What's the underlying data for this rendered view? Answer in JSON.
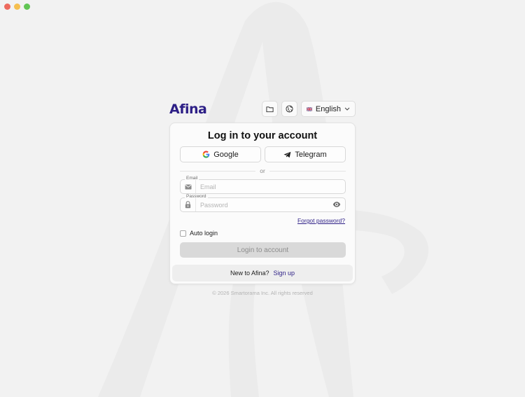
{
  "app": {
    "logo_text": "Afina"
  },
  "topbar": {
    "folder_icon": "folder-icon",
    "globe_icon": "globe-icon",
    "language": {
      "flag_icon": "uk-flag-icon",
      "selected": "English"
    }
  },
  "card": {
    "title": "Log in to your account",
    "social": {
      "google_label": "Google",
      "telegram_label": "Telegram"
    },
    "divider_text": "or",
    "email": {
      "label": "Email",
      "placeholder": "Email",
      "value": ""
    },
    "password": {
      "label": "Password",
      "placeholder": "Password",
      "value": ""
    },
    "forgot_label": "Forgot password?",
    "auto_login_label": "Auto login",
    "auto_login_checked": false,
    "login_label": "Login to account",
    "signup_prompt": "New to Afina?",
    "signup_label": "Sign up"
  },
  "footer": {
    "copyright": "© 2026 Smartorama Inc. All rights reserved"
  },
  "colors": {
    "accent": "#2d1f86",
    "background": "#f2f2f2",
    "disabled_button": "#d9d9d9"
  }
}
